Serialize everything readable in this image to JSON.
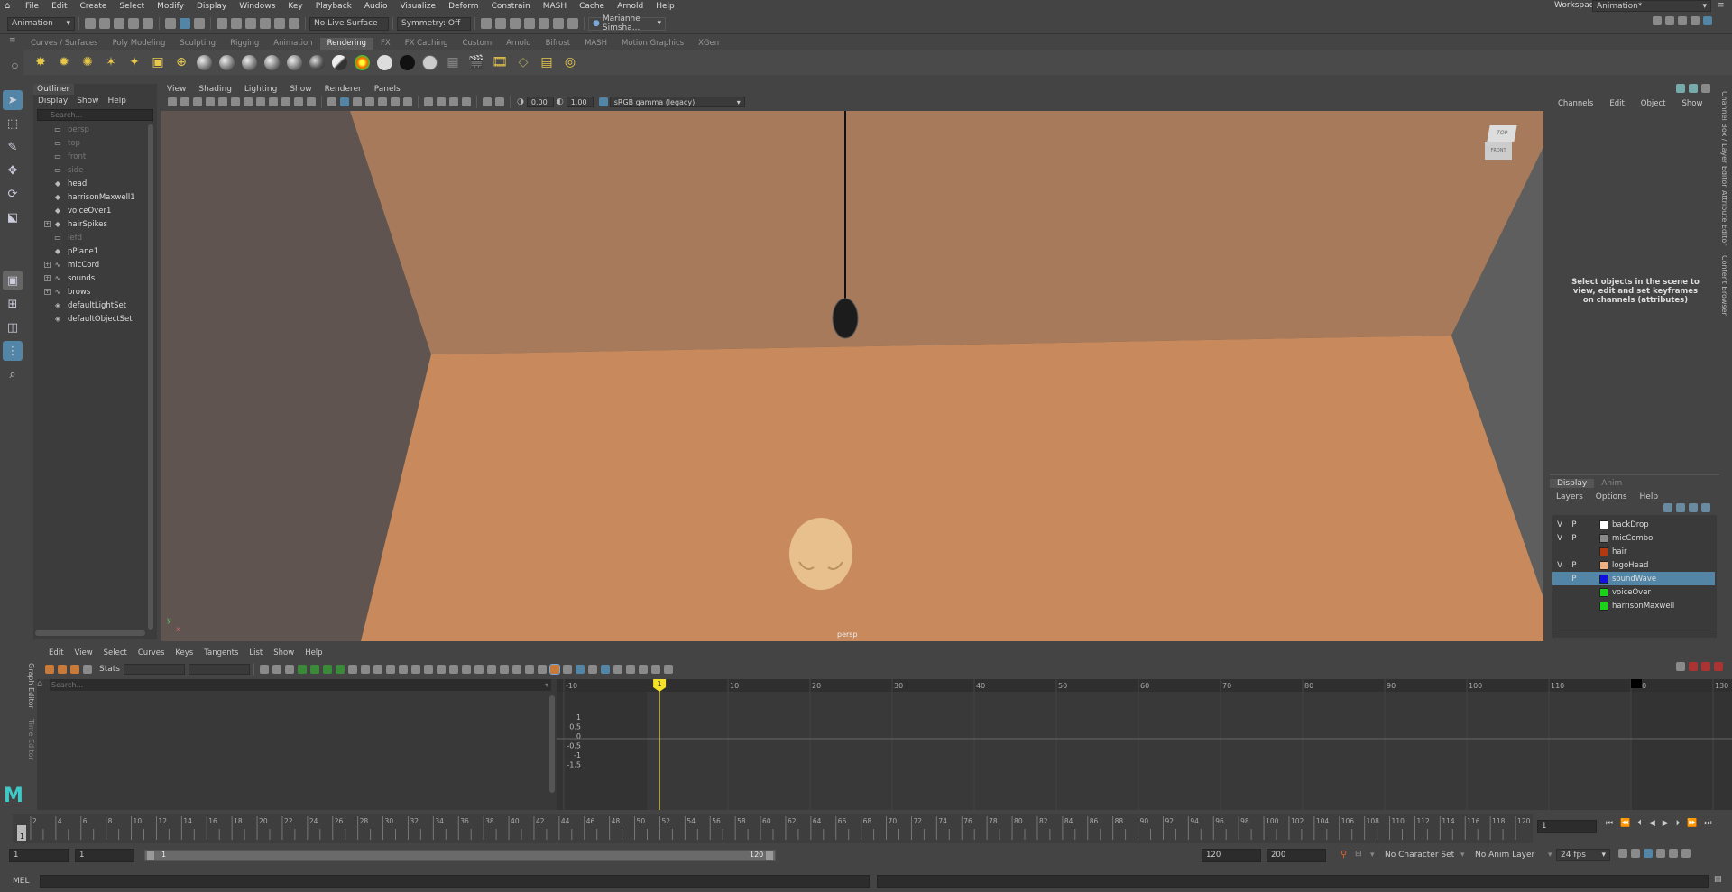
{
  "menubar": {
    "items": [
      "File",
      "Edit",
      "Create",
      "Select",
      "Modify",
      "Display",
      "Windows",
      "Key",
      "Playback",
      "Audio",
      "Visualize",
      "Deform",
      "Constrain",
      "MASH",
      "Cache",
      "Arnold",
      "Help"
    ],
    "workspace_label": "Workspace:",
    "workspace_value": "Animation*"
  },
  "statusline": {
    "menuset": "Animation",
    "live_surface": "No Live Surface",
    "symmetry": "Symmetry: Off",
    "user": "Marianne Simsha..."
  },
  "shelf": {
    "tabs": [
      "Curves / Surfaces",
      "Poly Modeling",
      "Sculpting",
      "Rigging",
      "Animation",
      "Rendering",
      "FX",
      "FX Caching",
      "Custom",
      "Arnold",
      "Bifrost",
      "MASH",
      "Motion Graphics",
      "XGen"
    ],
    "active_tab": "Rendering"
  },
  "outliner": {
    "title": "Outliner",
    "menu": [
      "Display",
      "Show",
      "Help"
    ],
    "search_placeholder": "Search...",
    "items": [
      {
        "label": "persp",
        "icon": "camera-icon",
        "dim": true,
        "expand": false
      },
      {
        "label": "top",
        "icon": "camera-icon",
        "dim": true,
        "expand": false
      },
      {
        "label": "front",
        "icon": "camera-icon",
        "dim": true,
        "expand": false
      },
      {
        "label": "side",
        "icon": "camera-icon",
        "dim": true,
        "expand": false
      },
      {
        "label": "head",
        "icon": "mesh-icon",
        "dim": false,
        "expand": false
      },
      {
        "label": "harrisonMaxwell1",
        "icon": "mesh-icon",
        "dim": false,
        "expand": false
      },
      {
        "label": "voiceOver1",
        "icon": "mesh-icon",
        "dim": false,
        "expand": false
      },
      {
        "label": "hairSpikes",
        "icon": "mesh-icon",
        "dim": false,
        "expand": true
      },
      {
        "label": "lefd",
        "icon": "camera-icon",
        "dim": true,
        "expand": false
      },
      {
        "label": "pPlane1",
        "icon": "mesh-icon",
        "dim": false,
        "expand": false
      },
      {
        "label": "micCord",
        "icon": "curve-icon",
        "dim": false,
        "expand": true
      },
      {
        "label": "sounds",
        "icon": "curve-icon",
        "dim": false,
        "expand": true
      },
      {
        "label": "brows",
        "icon": "curve-icon",
        "dim": false,
        "expand": true
      },
      {
        "label": "defaultLightSet",
        "icon": "set-icon",
        "dim": false,
        "expand": false
      },
      {
        "label": "defaultObjectSet",
        "icon": "set-icon",
        "dim": false,
        "expand": false
      }
    ]
  },
  "viewport": {
    "menu": [
      "View",
      "Shading",
      "Lighting",
      "Show",
      "Renderer",
      "Panels"
    ],
    "field_a": "0.00",
    "field_b": "1.00",
    "colorspace": "sRGB gamma (legacy)",
    "camera_label": "persp",
    "cube_top": "TOP",
    "cube_front": "FRONT",
    "axis_y": "y",
    "axis_x": "x"
  },
  "channelbox": {
    "menu": [
      "Channels",
      "Edit",
      "Object",
      "Show"
    ],
    "message": "Select objects in the scene to view, edit and set keyframes on channels (attributes)"
  },
  "layereditor": {
    "tabs": [
      "Display",
      "Anim"
    ],
    "menu": [
      "Layers",
      "Options",
      "Help"
    ],
    "layers": [
      {
        "v": "V",
        "p": "P",
        "name": "backDrop",
        "color": "#ffffff",
        "selected": false
      },
      {
        "v": "V",
        "p": "P",
        "name": "micCombo",
        "color": "#8a8a8a",
        "selected": false
      },
      {
        "v": "",
        "p": "",
        "name": "hair",
        "color": "#b33a0e",
        "selected": false
      },
      {
        "v": "V",
        "p": "P",
        "name": "logoHead",
        "color": "#f0b080",
        "selected": false
      },
      {
        "v": "",
        "p": "P",
        "name": "soundWave",
        "color": "#1010e0",
        "selected": true
      },
      {
        "v": "",
        "p": "",
        "name": "voiceOver",
        "color": "#19d219",
        "selected": false
      },
      {
        "v": "",
        "p": "",
        "name": "harrisonMaxwell",
        "color": "#19d219",
        "selected": false
      }
    ]
  },
  "sidetabs": [
    "Channel Box / Layer Editor",
    "Attribute Editor",
    "Content Browser"
  ],
  "grapheditor": {
    "menu": [
      "Edit",
      "View",
      "Select",
      "Curves",
      "Keys",
      "Tangents",
      "List",
      "Show",
      "Help"
    ],
    "stats_label": "Stats",
    "search_placeholder": "Search...",
    "side_label": "Graph Editor",
    "side_label2": "Time Editor",
    "x_ticks": [
      "-10",
      "10",
      "20",
      "30",
      "40",
      "50",
      "60",
      "70",
      "80",
      "90",
      "100",
      "110",
      "120",
      "130"
    ],
    "y_ticks": [
      "1",
      "0.5",
      "0",
      "-0.5",
      "-1",
      "-1.5"
    ],
    "current_frame": "1",
    "end_marker": "120"
  },
  "timeslider": {
    "ticks": [
      "2",
      "4",
      "6",
      "8",
      "10",
      "12",
      "14",
      "16",
      "18",
      "20",
      "22",
      "24",
      "26",
      "28",
      "30",
      "32",
      "34",
      "36",
      "38",
      "40",
      "42",
      "44",
      "46",
      "48",
      "50",
      "52",
      "54",
      "56",
      "58",
      "60",
      "62",
      "64",
      "66",
      "68",
      "70",
      "72",
      "74",
      "76",
      "78",
      "80",
      "82",
      "84",
      "86",
      "88",
      "90",
      "92",
      "94",
      "96",
      "98",
      "100",
      "102",
      "104",
      "106",
      "108",
      "110",
      "112",
      "114",
      "116",
      "118",
      "120"
    ],
    "current_frame_field": "1",
    "current_marker": "1"
  },
  "rangeslider": {
    "start_a": "1",
    "start_b": "1",
    "slider_start": "1",
    "slider_end": "120",
    "end_a": "120",
    "end_b": "200",
    "character_set": "No Character Set",
    "anim_layer": "No Anim Layer",
    "fps": "24 fps"
  },
  "cmdline": {
    "label": "MEL"
  },
  "colors": {
    "accent": "#5285a6",
    "wall": "#a67a5b",
    "floor": "#c88a5c",
    "keyframe_marker": "#f5e12a"
  }
}
